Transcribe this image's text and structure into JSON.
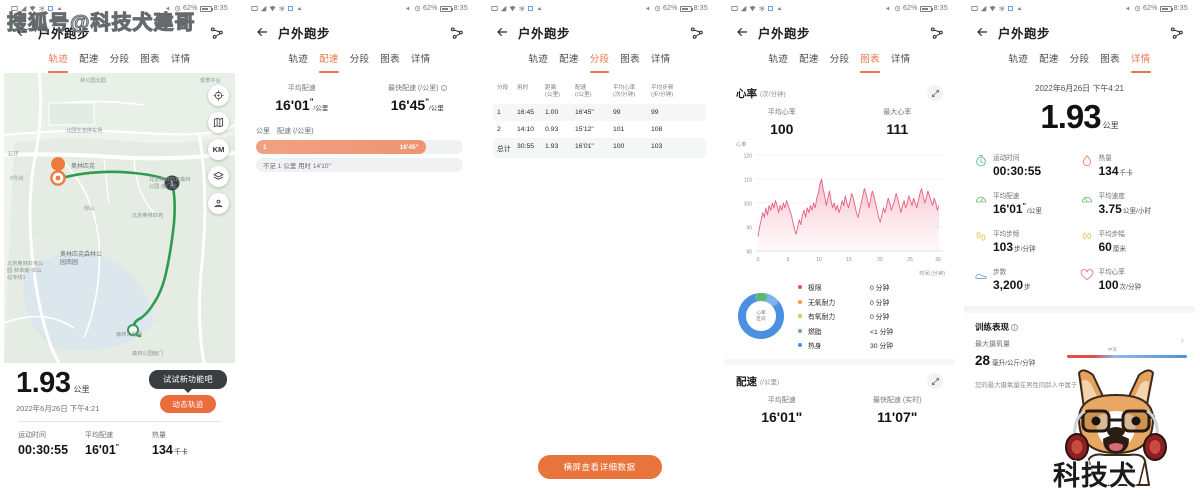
{
  "watermarks": {
    "sohu": "搜狐号@科技犬建哥",
    "dog_text": "科技犬"
  },
  "status_bar": {
    "battery": "62%",
    "time": "8:35"
  },
  "nav": {
    "title": "户外跑步",
    "back_icon": "back-arrow-icon",
    "share_icon": "share-icon"
  },
  "tabs": [
    {
      "label": "轨迹"
    },
    {
      "label": "配速"
    },
    {
      "label": "分段"
    },
    {
      "label": "图表"
    },
    {
      "label": "详情"
    }
  ],
  "panel1": {
    "active_tab": 0,
    "map_controls": [
      "locate-icon",
      "map-layers-icon",
      "KM",
      "layers-stack-icon",
      "terrain-icon"
    ],
    "map_labels": [
      "林公园北园",
      "观景平台",
      "北园生态停车场",
      "五环",
      "8号线",
      "奥林匹克",
      "北京奥林匹克森林公园·南门站",
      "奥林匹克森林公园南园",
      "北京奥林匹克公园·林萃南·仰山站专线1",
      "森林公园南门",
      "森林公剧场",
      "北京奥林匹克",
      "仰山"
    ],
    "tooltip": "试试新功能吧",
    "dynamic_track_button": "动态轨迹",
    "distance_value": "1.93",
    "distance_unit": "公里",
    "date": "2022年6月26日 下午4:21",
    "stats": [
      {
        "label": "运动时间",
        "value": "00:30:55",
        "unit": ""
      },
      {
        "label": "平均配速",
        "value": "16'01",
        "sup": "\"",
        "unit": ""
      },
      {
        "label": "热量",
        "value": "134",
        "unit": "千卡"
      }
    ]
  },
  "panel2": {
    "active_tab": 1,
    "summary": [
      {
        "label": "平均配速",
        "value": "16'01",
        "sup": "\"",
        "unit": "/公里",
        "has_info": false
      },
      {
        "label": "最快配速 (/公里)",
        "value": "16'45",
        "sup": "\"",
        "unit": "/公里",
        "has_info": true
      }
    ],
    "pace_header": [
      "公里",
      "配速 (/公里)"
    ],
    "bars": [
      {
        "km": "1",
        "pace": "16'45\"",
        "fill_pct": 82
      }
    ],
    "partial": "不足 1 公里 用时 14'10\""
  },
  "panel3": {
    "active_tab": 2,
    "table": {
      "headers": [
        "分段",
        "用时",
        "距离\n(公里)",
        "配速\n(/公里)",
        "平均心率\n(次/分钟)",
        "平均步频\n(步/分钟)"
      ],
      "headers_flat": [
        "分段",
        "用时",
        "距离",
        "配速",
        "平均心率",
        "平均步频"
      ],
      "header_units": [
        "",
        "",
        "(公里)",
        "(/公里)",
        "(次/分钟)",
        "(步/分钟)"
      ],
      "rows": [
        [
          "1",
          "16:45",
          "1.00",
          "16'45\"",
          "99",
          "99"
        ],
        [
          "2",
          "14:10",
          "0.93",
          "15'12\"",
          "101",
          "108"
        ],
        [
          "总计",
          "30:55",
          "1.93",
          "16'01\"",
          "100",
          "103"
        ]
      ]
    },
    "landscape_button": "横屏查看详细数据"
  },
  "panel4": {
    "active_tab": 3,
    "heart_rate": {
      "title": "心率",
      "subtitle": "(次/分钟)",
      "avg_label": "平均心率",
      "avg_value": "100",
      "max_label": "最大心率",
      "max_value": "111"
    },
    "zones_donut_center": [
      "心率",
      "区间"
    ],
    "zones": [
      {
        "name": "极限",
        "value": "0 分钟",
        "color": "#e35757"
      },
      {
        "name": "无氧耐力",
        "value": "0 分钟",
        "color": "#ef9a3c"
      },
      {
        "name": "有氧耐力",
        "value": "0 分钟",
        "color": "#e0c83c"
      },
      {
        "name": "燃脂",
        "value": "<1 分钟",
        "color": "#5bb86c"
      },
      {
        "name": "热身",
        "value": "30 分钟",
        "color": "#4b8fe0"
      }
    ],
    "pace": {
      "title": "配速",
      "subtitle": "(/公里)",
      "avg_label": "平均配速",
      "avg_value": "16'01\"",
      "max_label": "最快配速 (实时)",
      "max_value": "11'07\""
    }
  },
  "panel5": {
    "active_tab": 4,
    "date": "2022年6月26日 下午4:21",
    "distance_value": "1.93",
    "distance_unit": "公里",
    "metrics": [
      {
        "icon": "stopwatch-icon",
        "label": "运动时间",
        "value": "00:30:55",
        "unit": "",
        "color": "#5cb894"
      },
      {
        "icon": "flame-icon",
        "label": "热量",
        "value": "134",
        "unit": "千卡",
        "color": "#ef8a62"
      },
      {
        "icon": "speedometer-icon",
        "label": "平均配速",
        "value": "16'01",
        "sup": "\"",
        "unit": "/公里",
        "color": "#7cc47f"
      },
      {
        "icon": "speed-gauge-icon",
        "label": "平均速度",
        "value": "3.75",
        "unit": "公里/小时",
        "color": "#7cc47f"
      },
      {
        "icon": "footsteps-icon",
        "label": "平均步频",
        "value": "103",
        "unit": "步/分钟",
        "color": "#e3c44f"
      },
      {
        "icon": "stride-icon",
        "label": "平均步幅",
        "value": "60",
        "unit": "厘米",
        "color": "#e3c44f"
      },
      {
        "icon": "shoe-icon",
        "label": "步数",
        "value": "3,200",
        "unit": "步",
        "color": "#6fa8dc"
      },
      {
        "icon": "heart-icon",
        "label": "平均心率",
        "value": "100",
        "unit": "次/分钟",
        "color": "#e07a9a"
      }
    ],
    "training": {
      "title": "训练表现",
      "vo2_label": "最大摄氧量",
      "vo2_value": "28",
      "vo2_unit": "毫升/公斤/分钟",
      "note": "您的最大摄氧量在男性同龄人中属于",
      "tick": "中等",
      "chevron": "chevron-right-icon"
    }
  },
  "chart_data": {
    "type": "line",
    "title": "心率",
    "ylabel": "心率",
    "xlabel": "时间 (分钟)",
    "ylim": [
      80,
      120
    ],
    "yticks": [
      80,
      90,
      100,
      110,
      120
    ],
    "xticks": [
      0,
      5,
      10,
      15,
      20,
      25,
      30
    ],
    "xlim": [
      0,
      31
    ],
    "series": [
      {
        "name": "心率 (次/分钟)",
        "color": "#e8607f",
        "values": [
          86,
          90,
          93,
          96,
          94,
          98,
          95,
          99,
          97,
          100,
          98,
          101,
          99,
          96,
          99,
          97,
          100,
          98,
          101,
          99,
          97,
          95,
          92,
          89,
          87,
          90,
          93,
          91,
          95,
          97,
          94,
          98,
          96,
          99,
          97,
          100,
          98,
          102,
          104,
          108,
          110,
          106,
          103,
          99,
          102,
          105,
          101,
          98,
          100,
          97,
          99,
          96,
          98,
          101,
          99,
          103,
          100,
          98,
          101,
          104,
          102,
          99,
          96,
          94,
          97,
          100,
          103,
          106,
          104,
          101,
          98,
          102,
          105,
          103,
          100,
          97,
          94,
          92,
          95,
          98,
          96,
          99,
          102,
          100,
          97,
          99,
          101,
          104,
          102,
          99,
          96,
          99,
          101,
          98,
          100,
          103,
          101,
          99,
          102,
          100,
          98,
          101,
          104,
          106,
          103,
          100,
          102,
          105,
          103,
          101,
          99,
          102,
          100,
          97,
          99
        ]
      }
    ]
  }
}
